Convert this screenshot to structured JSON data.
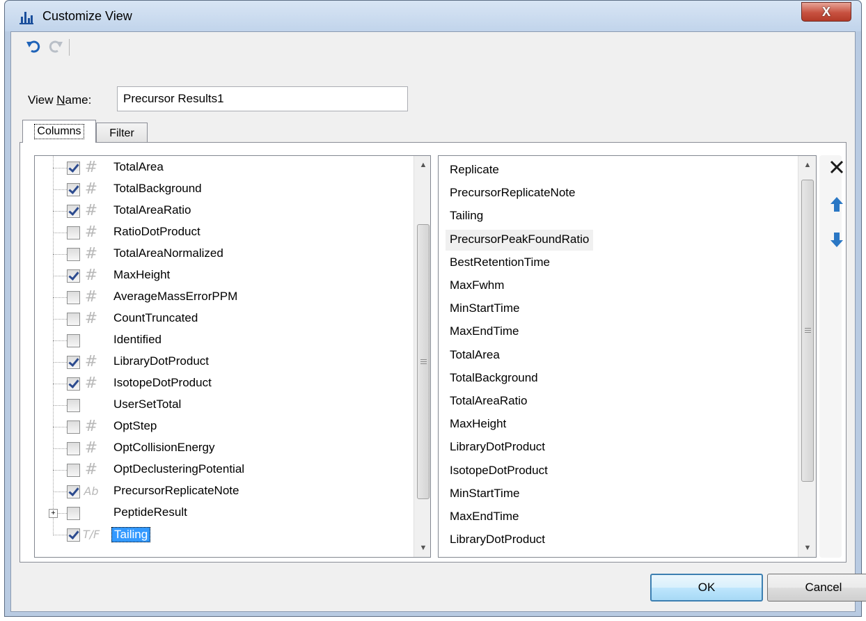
{
  "window": {
    "title": "Customize View",
    "close_label": "X"
  },
  "toolbar": {
    "undo_icon": "undo-icon",
    "redo_icon": "redo-icon"
  },
  "view_name": {
    "label_prefix": "View ",
    "label_access_key": "N",
    "label_suffix": "ame:",
    "value": "Precursor Results1"
  },
  "tabs": [
    {
      "label": "Columns",
      "selected": true
    },
    {
      "label": "Filter",
      "selected": false
    }
  ],
  "tree": {
    "items": [
      {
        "label": "TotalArea",
        "checked": true,
        "type": "#"
      },
      {
        "label": "TotalBackground",
        "checked": true,
        "type": "#"
      },
      {
        "label": "TotalAreaRatio",
        "checked": true,
        "type": "#"
      },
      {
        "label": "RatioDotProduct",
        "checked": false,
        "type": "#"
      },
      {
        "label": "TotalAreaNormalized",
        "checked": false,
        "type": "#"
      },
      {
        "label": "MaxHeight",
        "checked": true,
        "type": "#"
      },
      {
        "label": "AverageMassErrorPPM",
        "checked": false,
        "type": "#"
      },
      {
        "label": "CountTruncated",
        "checked": false,
        "type": "#"
      },
      {
        "label": "Identified",
        "checked": false,
        "type": ""
      },
      {
        "label": "LibraryDotProduct",
        "checked": true,
        "type": "#"
      },
      {
        "label": "IsotopeDotProduct",
        "checked": true,
        "type": "#"
      },
      {
        "label": "UserSetTotal",
        "checked": false,
        "type": ""
      },
      {
        "label": "OptStep",
        "checked": false,
        "type": "#"
      },
      {
        "label": "OptCollisionEnergy",
        "checked": false,
        "type": "#"
      },
      {
        "label": "OptDeclusteringPotential",
        "checked": false,
        "type": "#"
      },
      {
        "label": "PrecursorReplicateNote",
        "checked": true,
        "type": "Ab"
      },
      {
        "label": "PeptideResult",
        "checked": false,
        "type": "",
        "expandable": true
      },
      {
        "label": "Tailing",
        "checked": true,
        "type": "T/F",
        "selected": true
      }
    ],
    "scroll_position": 0.55,
    "scroll_thumb_fraction": 0.75
  },
  "columns_list": {
    "items": [
      "Replicate",
      "PrecursorReplicateNote",
      "Tailing",
      "PrecursorPeakFoundRatio",
      "BestRetentionTime",
      "MaxFwhm",
      "MinStartTime",
      "MaxEndTime",
      "TotalArea",
      "TotalBackground",
      "TotalAreaRatio",
      "MaxHeight",
      "LibraryDotProduct",
      "IsotopeDotProduct",
      "MinStartTime",
      "MaxEndTime",
      "LibraryDotProduct"
    ],
    "hover_index": 3,
    "scroll_position": 0.0,
    "scroll_thumb_fraction": 0.85
  },
  "side_buttons": {
    "remove_icon": "close-icon",
    "up_icon": "arrow-up-icon",
    "down_icon": "arrow-down-icon"
  },
  "buttons": {
    "ok": "OK",
    "cancel": "Cancel"
  },
  "colors": {
    "selection": "#3399ff",
    "arrow_blue": "#2a77c4",
    "window_frame": "#b9cbe2"
  }
}
